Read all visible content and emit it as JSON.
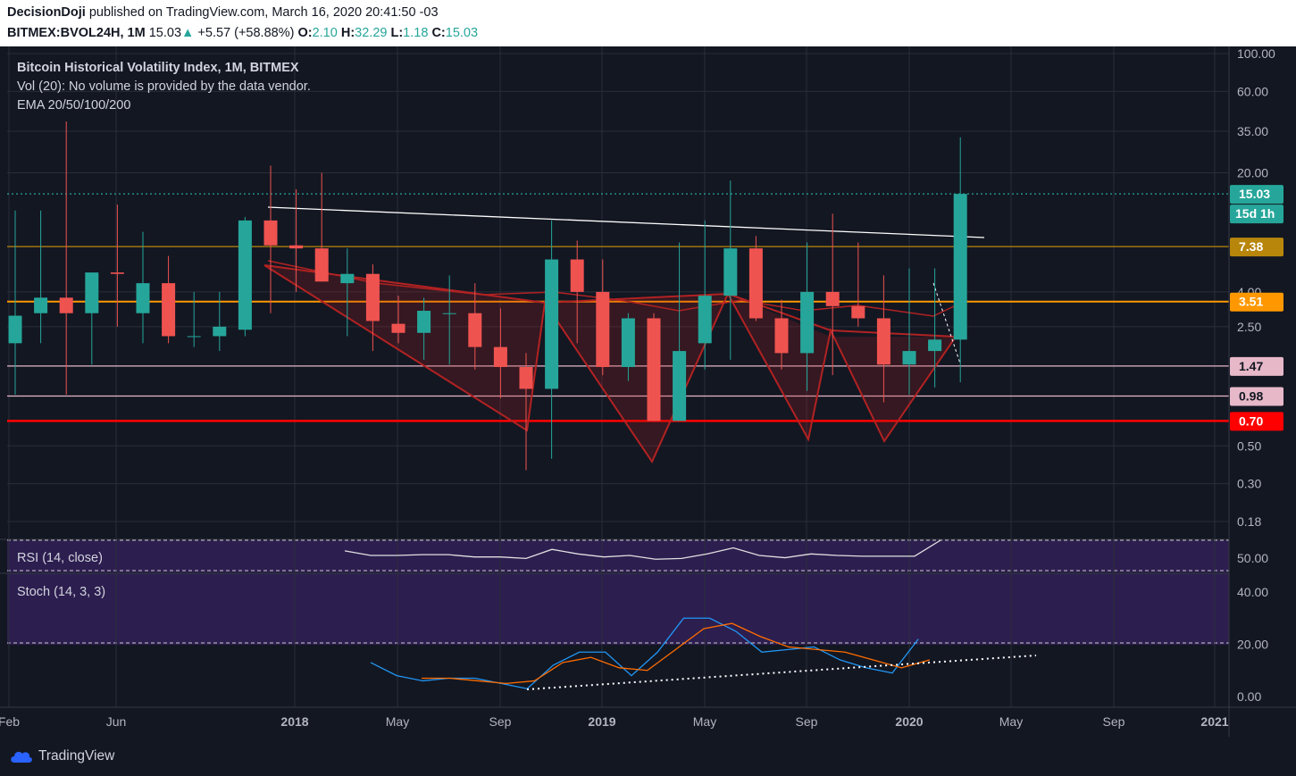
{
  "header": {
    "author": "DecisionDoji",
    "published_text": "published on TradingView.com, March 16, 2020 20:41:50 -03",
    "symbol": "BITMEX:BVOL24H, 1M",
    "last": "15.03",
    "change_arrow": "▲",
    "change": "+5.57 (+58.88%)",
    "o_label": "O:",
    "o_val": "2.10",
    "h_label": "H:",
    "h_val": "32.29",
    "l_label": "L:",
    "l_val": "1.18",
    "c_label": "C:",
    "c_val": "15.03"
  },
  "legend": {
    "title": "Bitcoin Historical Volatility Index, 1M, BITMEX",
    "vol": "Vol (20): No volume is provided by the data vendor.",
    "ema": "EMA 20/50/100/200",
    "rsi": "RSI (14, close)",
    "stoch": "Stoch (14, 3, 3)"
  },
  "footer": {
    "brand": "TradingView"
  },
  "colors": {
    "bg": "#131722",
    "up": "#26a69a",
    "down": "#ef5350",
    "grid": "#2a2e39",
    "text": "#b2b5be",
    "red_line": "#ff0000",
    "orange_line": "#ff9800",
    "gold_line": "#b8860b",
    "pink_line": "#e6b8c8",
    "pattern": "#b22222",
    "stoch_k": "#2196f3",
    "stoch_d": "#ff6d00",
    "rsi_panel": "#2d1e50",
    "stoch_panel": "#2d1e50"
  },
  "chart_data": {
    "type": "candlestick",
    "scale": "log",
    "timeframe": "1M",
    "x_labels": [
      "Feb",
      "Jun",
      "2018",
      "May",
      "Sep",
      "2019",
      "May",
      "Sep",
      "2020",
      "May",
      "Sep",
      "2021"
    ],
    "y_tick_labels": [
      "100.00",
      "60.00",
      "35.00",
      "20.00",
      "7.38",
      "4.00",
      "2.50",
      "1.47",
      "0.98",
      "0.50",
      "0.30",
      "0.18"
    ],
    "price_badges": [
      {
        "label": "15.03",
        "sub": "15d 1h",
        "color": "#26a69a"
      },
      {
        "label": "7.38",
        "color": "#b8860b"
      },
      {
        "label": "3.51",
        "color": "#ff9800"
      },
      {
        "label": "1.47",
        "color": "#e6b8c8"
      },
      {
        "label": "0.98",
        "color": "#e6b8c8"
      },
      {
        "label": "0.70",
        "color": "#ff0000"
      }
    ],
    "horizontal_levels": [
      {
        "value": 15.03,
        "style": "dotted",
        "color": "#26a69a"
      },
      {
        "value": 7.38,
        "color": "#b8860b"
      },
      {
        "value": 3.51,
        "color": "#ff9800"
      },
      {
        "value": 1.47,
        "color": "#e6b8c8"
      },
      {
        "value": 0.98,
        "color": "#e6b8c8"
      },
      {
        "value": 0.7,
        "color": "#ff0000"
      }
    ],
    "candles": [
      {
        "t": "2017-02",
        "o": 2.0,
        "h": 12.0,
        "l": 1.0,
        "c": 2.9
      },
      {
        "t": "2017-03",
        "o": 3.0,
        "h": 12.0,
        "l": 2.0,
        "c": 3.7
      },
      {
        "t": "2017-04",
        "o": 3.7,
        "h": 40.0,
        "l": 1.0,
        "c": 3.0
      },
      {
        "t": "2017-05",
        "o": 3.0,
        "h": 4.0,
        "l": 1.5,
        "c": 5.2
      },
      {
        "t": "2017-06",
        "o": 5.2,
        "h": 13.0,
        "l": 2.5,
        "c": 5.1
      },
      {
        "t": "2017-07",
        "o": 3.0,
        "h": 9.0,
        "l": 2.0,
        "c": 4.5
      },
      {
        "t": "2017-08",
        "o": 4.5,
        "h": 6.5,
        "l": 2.0,
        "c": 2.2
      },
      {
        "t": "2017-09",
        "o": 2.2,
        "h": 4.0,
        "l": 1.9,
        "c": 2.2
      },
      {
        "t": "2017-10",
        "o": 2.2,
        "h": 4.0,
        "l": 1.8,
        "c": 2.5
      },
      {
        "t": "2017-11",
        "o": 2.4,
        "h": 11.0,
        "l": 2.2,
        "c": 10.5
      },
      {
        "t": "2017-12",
        "o": 10.5,
        "h": 22.0,
        "l": 3.0,
        "c": 7.5
      },
      {
        "t": "2018-01",
        "o": 7.5,
        "h": 16.0,
        "l": 4.0,
        "c": 7.2
      },
      {
        "t": "2018-02",
        "o": 7.2,
        "h": 20.0,
        "l": 4.6,
        "c": 4.6
      },
      {
        "t": "2018-03",
        "o": 4.5,
        "h": 7.2,
        "l": 2.2,
        "c": 5.1
      },
      {
        "t": "2018-04",
        "o": 5.1,
        "h": 5.8,
        "l": 1.8,
        "c": 2.7
      },
      {
        "t": "2018-05",
        "o": 2.6,
        "h": 3.8,
        "l": 2.0,
        "c": 2.3
      },
      {
        "t": "2018-06",
        "o": 2.3,
        "h": 3.7,
        "l": 1.6,
        "c": 3.1
      },
      {
        "t": "2018-07",
        "o": 3.0,
        "h": 5.0,
        "l": 1.5,
        "c": 3.0
      },
      {
        "t": "2018-08",
        "o": 3.0,
        "h": 4.5,
        "l": 1.4,
        "c": 1.9
      },
      {
        "t": "2018-09",
        "o": 1.9,
        "h": 3.2,
        "l": 0.95,
        "c": 1.45
      },
      {
        "t": "2018-10",
        "o": 1.45,
        "h": 1.75,
        "l": 0.36,
        "c": 1.08
      },
      {
        "t": "2018-11",
        "o": 1.08,
        "h": 10.5,
        "l": 0.42,
        "c": 6.2
      },
      {
        "t": "2018-12",
        "o": 6.2,
        "h": 8.0,
        "l": 2.0,
        "c": 4.0
      },
      {
        "t": "2019-01",
        "o": 4.0,
        "h": 6.2,
        "l": 1.3,
        "c": 1.45
      },
      {
        "t": "2019-02",
        "o": 1.45,
        "h": 3.0,
        "l": 1.2,
        "c": 2.8
      },
      {
        "t": "2019-03",
        "o": 2.8,
        "h": 3.0,
        "l": 0.7,
        "c": 0.7
      },
      {
        "t": "2019-04",
        "o": 0.7,
        "h": 7.8,
        "l": 0.7,
        "c": 1.8
      },
      {
        "t": "2019-05",
        "o": 2.0,
        "h": 10.5,
        "l": 1.4,
        "c": 3.8
      },
      {
        "t": "2019-06",
        "o": 3.8,
        "h": 18.0,
        "l": 1.6,
        "c": 7.2
      },
      {
        "t": "2019-07",
        "o": 7.2,
        "h": 8.5,
        "l": 2.7,
        "c": 2.8
      },
      {
        "t": "2019-08",
        "o": 2.8,
        "h": 3.6,
        "l": 1.4,
        "c": 1.75
      },
      {
        "t": "2019-09",
        "o": 1.75,
        "h": 7.8,
        "l": 1.05,
        "c": 4.0
      },
      {
        "t": "2019-10",
        "o": 4.0,
        "h": 11.5,
        "l": 1.3,
        "c": 3.3
      },
      {
        "t": "2019-11",
        "o": 3.3,
        "h": 7.8,
        "l": 2.5,
        "c": 2.8
      },
      {
        "t": "2019-12",
        "o": 2.8,
        "h": 5.0,
        "l": 0.9,
        "c": 1.5
      },
      {
        "t": "2020-01",
        "o": 1.5,
        "h": 5.5,
        "l": 1.0,
        "c": 1.8
      },
      {
        "t": "2020-02",
        "o": 1.8,
        "h": 5.5,
        "l": 1.1,
        "c": 2.1
      },
      {
        "t": "2020-03",
        "o": 2.1,
        "h": 32.29,
        "l": 1.18,
        "c": 15.03
      }
    ],
    "rsi": {
      "overbought": 70,
      "oversold": 30,
      "y_tick": "50.00",
      "values": [
        56,
        50,
        50,
        51,
        51,
        48,
        48,
        46,
        58,
        52,
        48,
        50,
        45,
        46,
        52,
        60,
        50,
        47,
        52,
        50,
        49,
        49,
        49,
        70
      ]
    },
    "stoch": {
      "y_labels": [
        "40.00",
        "20.00",
        "0.00"
      ],
      "k": [
        13,
        8,
        6,
        7,
        7,
        5,
        3,
        12,
        17,
        17,
        8,
        17,
        30,
        30,
        25,
        17,
        18,
        19,
        14,
        11,
        9,
        22
      ],
      "d": [
        7,
        7,
        6,
        5,
        6,
        13,
        15,
        11,
        10,
        18,
        26,
        28,
        23,
        19,
        18,
        17,
        14,
        11,
        14
      ]
    },
    "grid": true
  }
}
